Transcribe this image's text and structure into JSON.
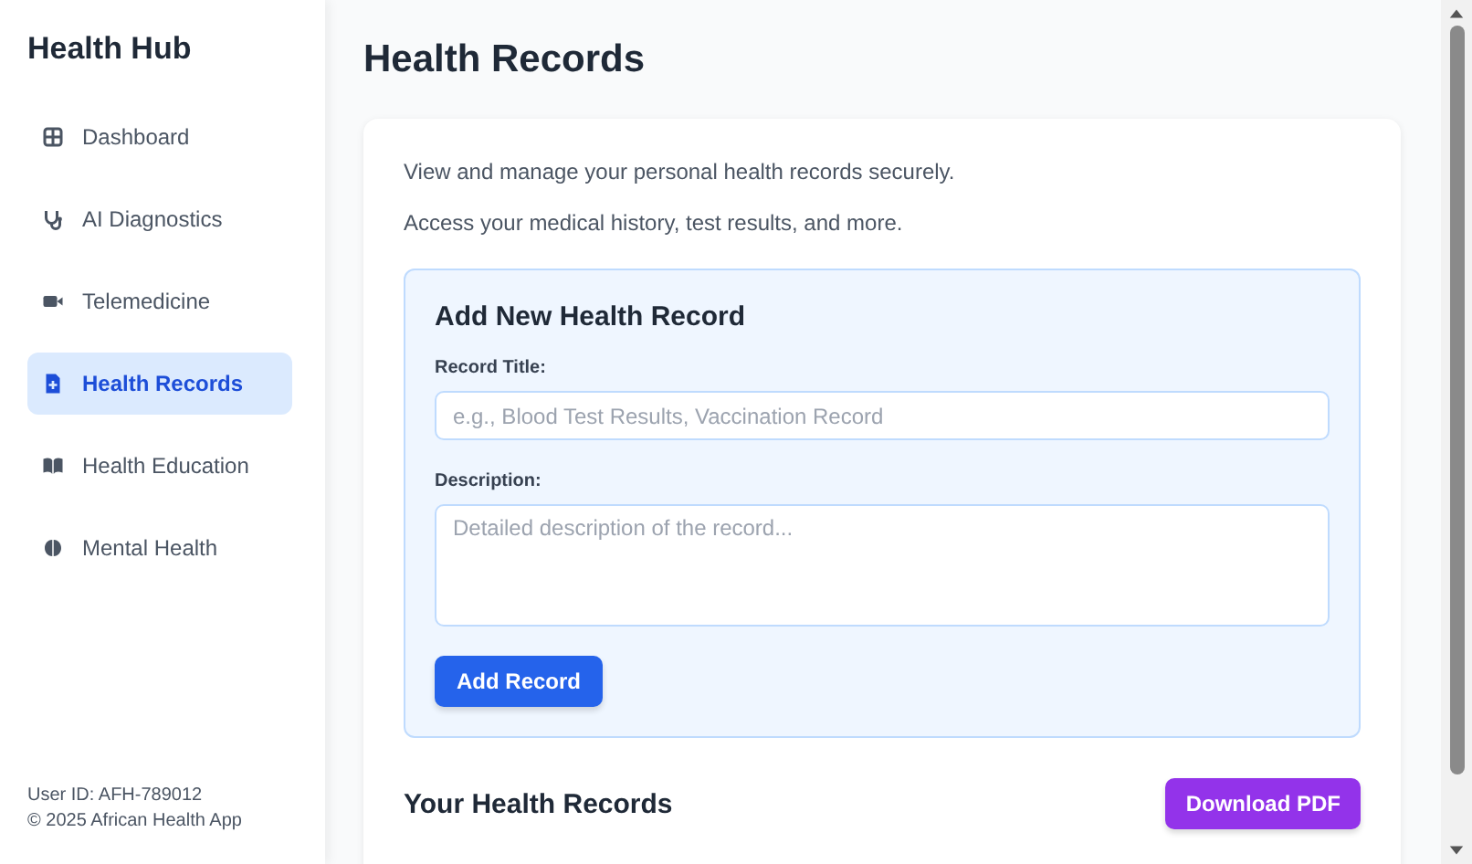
{
  "sidebar": {
    "title": "Health Hub",
    "items": [
      {
        "label": "Dashboard",
        "selected": false
      },
      {
        "label": "AI Diagnostics",
        "selected": false
      },
      {
        "label": "Telemedicine",
        "selected": false
      },
      {
        "label": "Health Records",
        "selected": true
      },
      {
        "label": "Health Education",
        "selected": false
      },
      {
        "label": "Mental Health",
        "selected": false
      }
    ],
    "footer": [
      "User ID: AFH-789012",
      "© 2025 African Health App"
    ]
  },
  "main": {
    "title": "Health Records",
    "intro": [
      "View and manage your personal health records securely.",
      "Access your medical history, test results, and more."
    ],
    "form": {
      "title": "Add New Health Record",
      "fields": [
        {
          "kind": "input",
          "label": "Record Title:",
          "placeholder": "e.g., Blood Test Results, Vaccination Record"
        },
        {
          "kind": "textarea",
          "label": "Description:",
          "placeholder": "Detailed description of the record..."
        }
      ],
      "submit": "Add Record"
    },
    "records": {
      "title": "Your Health Records",
      "download": "Download PDF"
    }
  }
}
